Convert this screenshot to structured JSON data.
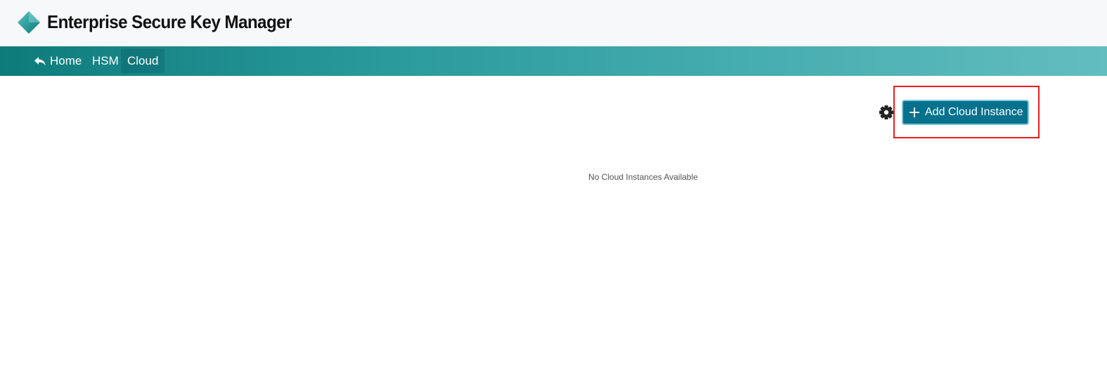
{
  "app": {
    "title": "Enterprise Secure Key Manager",
    "logo_icon": "diamond-logo-icon"
  },
  "nav": {
    "items": [
      {
        "label": "Home",
        "icon": "reply-arrow-icon",
        "active": false
      },
      {
        "label": "HSM",
        "active": false
      },
      {
        "label": "Cloud",
        "active": true
      }
    ]
  },
  "toolbar": {
    "settings_icon": "gear-icon",
    "add_button_label": "Add Cloud Instance",
    "add_button_icon": "plus-icon"
  },
  "main": {
    "empty_message": "No Cloud Instances Available"
  },
  "colors": {
    "nav_start": "#0e7b7b",
    "nav_end": "#62bdbf",
    "button": "#06718d",
    "highlight": "#ea1d1d"
  }
}
